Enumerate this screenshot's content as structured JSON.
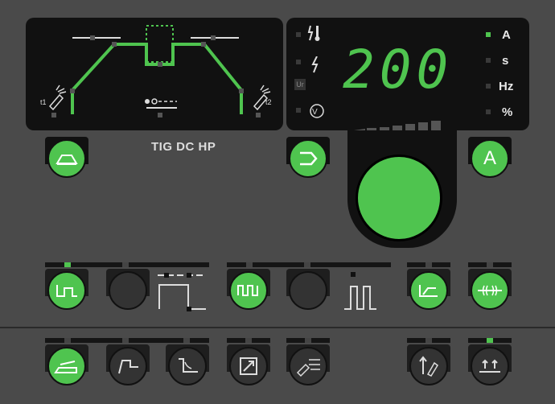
{
  "display": {
    "value": "200",
    "units": [
      "A",
      "s",
      "Hz",
      "%"
    ],
    "active_unit": "A"
  },
  "process": {
    "label": "TIG DC HP",
    "t1_label": "t1",
    "t2_label": "t2"
  },
  "buttons": {
    "parameter_set": "A"
  },
  "left_indicators": {
    "ur_label": "Ur"
  },
  "colors": {
    "accent": "#4fc44f",
    "panel": "#111111",
    "body": "#4a4a4a"
  }
}
